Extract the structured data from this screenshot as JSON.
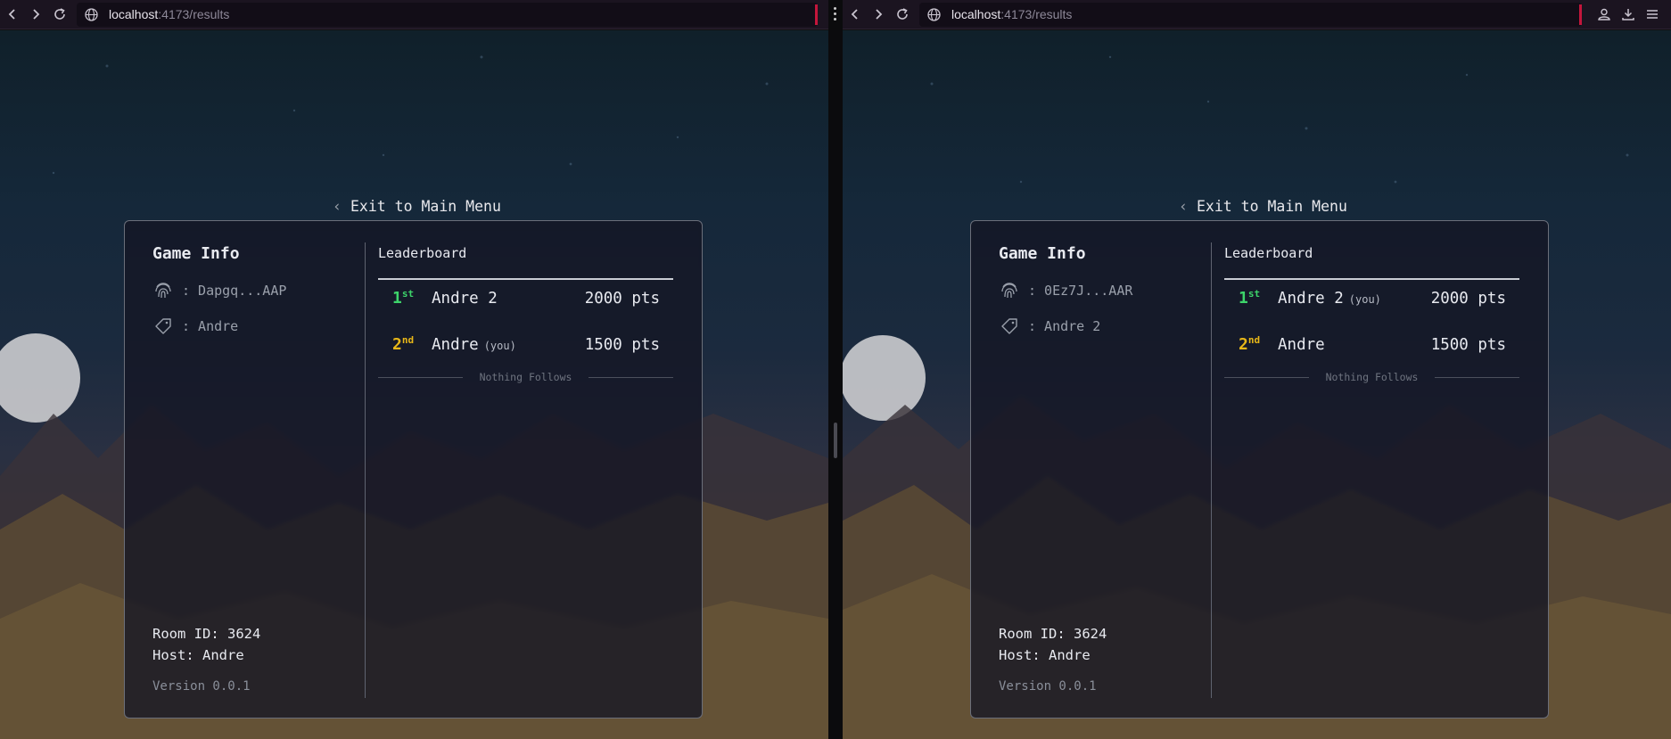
{
  "panes": [
    {
      "browser": {
        "url_host": "localhost",
        "url_path": ":4173/results"
      },
      "exit_label": "Exit to Main Menu",
      "game_info": {
        "title": "Game Info",
        "id_label": ": Dapgq...AAP",
        "name_label": ": Andre",
        "room_id": "Room ID: 3624",
        "host": "Host: Andre",
        "version": "Version 0.0.1"
      },
      "leaderboard": {
        "title": "Leaderboard",
        "rows": [
          {
            "rank_num": "1",
            "rank_suffix": "st",
            "name": "Andre 2",
            "you": "",
            "points": "2000 pts"
          },
          {
            "rank_num": "2",
            "rank_suffix": "nd",
            "name": "Andre",
            "you": "(you)",
            "points": "1500 pts"
          }
        ],
        "footer": "Nothing Follows"
      }
    },
    {
      "browser": {
        "url_host": "localhost",
        "url_path": ":4173/results"
      },
      "exit_label": "Exit to Main Menu",
      "game_info": {
        "title": "Game Info",
        "id_label": ": 0Ez7J...AAR",
        "name_label": ": Andre 2",
        "room_id": "Room ID: 3624",
        "host": "Host: Andre",
        "version": "Version 0.0.1"
      },
      "leaderboard": {
        "title": "Leaderboard",
        "rows": [
          {
            "rank_num": "1",
            "rank_suffix": "st",
            "name": "Andre 2",
            "you": "(you)",
            "points": "2000 pts"
          },
          {
            "rank_num": "2",
            "rank_suffix": "nd",
            "name": "Andre",
            "you": "",
            "points": "1500 pts"
          }
        ],
        "footer": "Nothing Follows"
      }
    }
  ],
  "colors": {
    "first_place": "#3dd46a",
    "second_place": "#e9b818",
    "accent_red": "#c4163c"
  },
  "icons": [
    "back-arrow-icon",
    "forward-arrow-icon",
    "reload-icon",
    "globe-icon",
    "fingerprint-icon",
    "tag-icon",
    "chevron-left-icon",
    "account-icon",
    "download-icon",
    "menu-icon"
  ]
}
